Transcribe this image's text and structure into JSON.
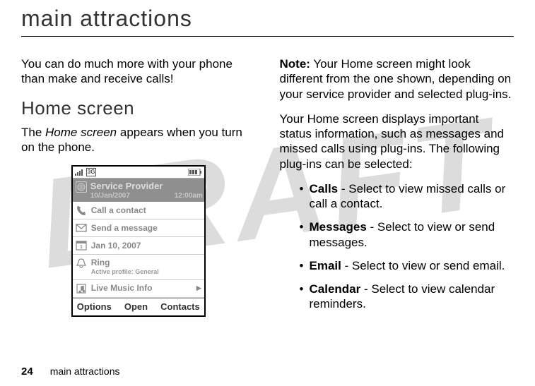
{
  "watermark": "DRAFT",
  "title": "main attractions",
  "left": {
    "intro": "You can do much more with your phone than make and receive calls!",
    "h2": "Home screen",
    "desc_pre": "The ",
    "desc_italic": "Home screen",
    "desc_post": " appears when you turn on the phone."
  },
  "phone": {
    "status": {
      "net": "3G"
    },
    "provider": {
      "title": "Service Provider",
      "date": "10/Jan/2007",
      "time": "12:00am"
    },
    "rows": {
      "call": "Call a contact",
      "msg": "Send a message",
      "cal": "Jan 10, 2007",
      "ring": "Ring",
      "ring_sub": "Active profile: General",
      "music": "Live Music Info"
    },
    "softkeys": {
      "left": "Options",
      "center": "Open",
      "right": "Contacts"
    }
  },
  "right": {
    "note_label": "Note:",
    "note_text": " Your Home screen might look different from the one shown, depending on your service provider and selected plug-ins.",
    "para2": "Your Home screen displays important status information, such as messages and missed calls using plug-ins. The following plug-ins can be selected:",
    "bullets": {
      "calls": {
        "label": "Calls",
        "text": " - Select to view missed calls or call a contact."
      },
      "messages": {
        "label": "Messages",
        "text": " - Select to view or send messages."
      },
      "email": {
        "label": "Email",
        "text": " - Select to view or send email."
      },
      "calendar": {
        "label": "Calendar",
        "text": " - Select to view calendar reminders."
      }
    }
  },
  "footer": {
    "page": "24",
    "section": "main attractions"
  }
}
